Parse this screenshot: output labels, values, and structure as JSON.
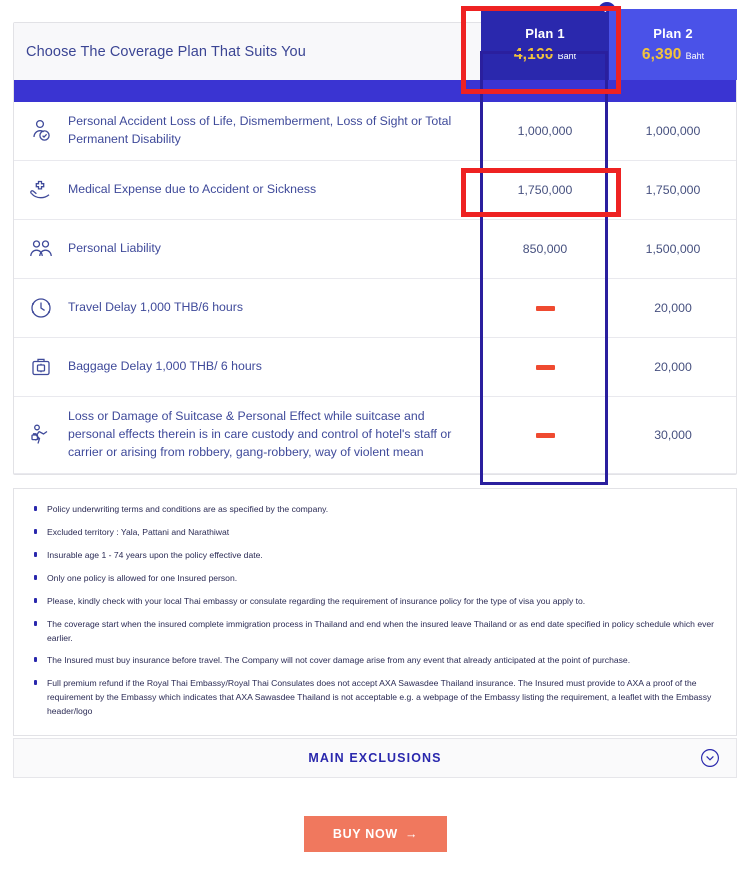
{
  "header": {
    "title": "Choose The Coverage Plan That Suits You"
  },
  "plans": [
    {
      "name": "Plan 1",
      "price": "4,160",
      "currency": "Baht",
      "selected": true,
      "check_icon": "✓"
    },
    {
      "name": "Plan 2",
      "price": "6,390",
      "currency": "Baht",
      "selected": false
    }
  ],
  "coverage_rows": [
    {
      "icon": "personal-accident-icon",
      "label": "Personal Accident Loss of Life, Dismemberment, Loss of Sight or Total Permanent Disability",
      "plan1": "1,000,000",
      "plan2": "1,000,000"
    },
    {
      "icon": "medical-expense-icon",
      "label": "Medical Expense due to Accident or Sickness",
      "plan1": "1,750,000",
      "plan2": "1,750,000"
    },
    {
      "icon": "personal-liability-icon",
      "label": "Personal Liability",
      "plan1": "850,000",
      "plan2": "1,500,000"
    },
    {
      "icon": "travel-delay-icon",
      "label": "Travel Delay 1,000 THB/6 hours",
      "plan1": "—",
      "plan2": "20,000"
    },
    {
      "icon": "baggage-delay-icon",
      "label": "Baggage Delay 1,000 THB/ 6 hours",
      "plan1": "—",
      "plan2": "20,000"
    },
    {
      "icon": "baggage-loss-icon",
      "label": "Loss or Damage of Suitcase & Personal Effect while suitcase and personal effects therein is in care custody and control of hotel's staff or carrier or arising from robbery, gang-robbery, way of violent mean",
      "plan1": "—",
      "plan2": "30,000"
    }
  ],
  "notes": [
    "Policy underwriting terms and conditions are as specified by the company.",
    "Excluded territory : Yala, Pattani and Narathiwat",
    "Insurable age 1 - 74 years upon the policy effective date.",
    "Only one policy is allowed for one Insured person.",
    "Please, kindly check with your local Thai embassy or consulate regarding the requirement of insurance policy for the type of visa you apply to.",
    "The coverage start when the insured complete immigration process in Thailand and end when the insured leave Thailand or as end date specified in policy schedule which ever earlier.",
    "The Insured must buy insurance before travel. The Company will not cover damage arise from any event that already anticipated at the point of purchase.",
    "Full premium refund if the Royal Thai Embassy/Royal Thai Consulates does not accept AXA Sawasdee Thailand insurance. The Insured must provide to AXA a proof of the requirement by the Embassy which indicates that AXA Sawasdee Thailand is not acceptable e.g. a webpage of the Embassy listing the requirement, a leaflet with the Embassy header/logo"
  ],
  "exclusions": {
    "title": "MAIN EXCLUSIONS",
    "chevron_icon": "chevron-down-icon"
  },
  "cta": {
    "label": "BUY NOW",
    "arrow": "→"
  },
  "colors": {
    "band_blue": "#3a34d2",
    "plan_selected": "#2a28ad",
    "plan_alt": "#4a52e8",
    "price_gold": "#f3c33c",
    "cta_coral": "#f0785e",
    "dash_coral": "#ef4a30",
    "annotation_red": "#ee2222"
  }
}
